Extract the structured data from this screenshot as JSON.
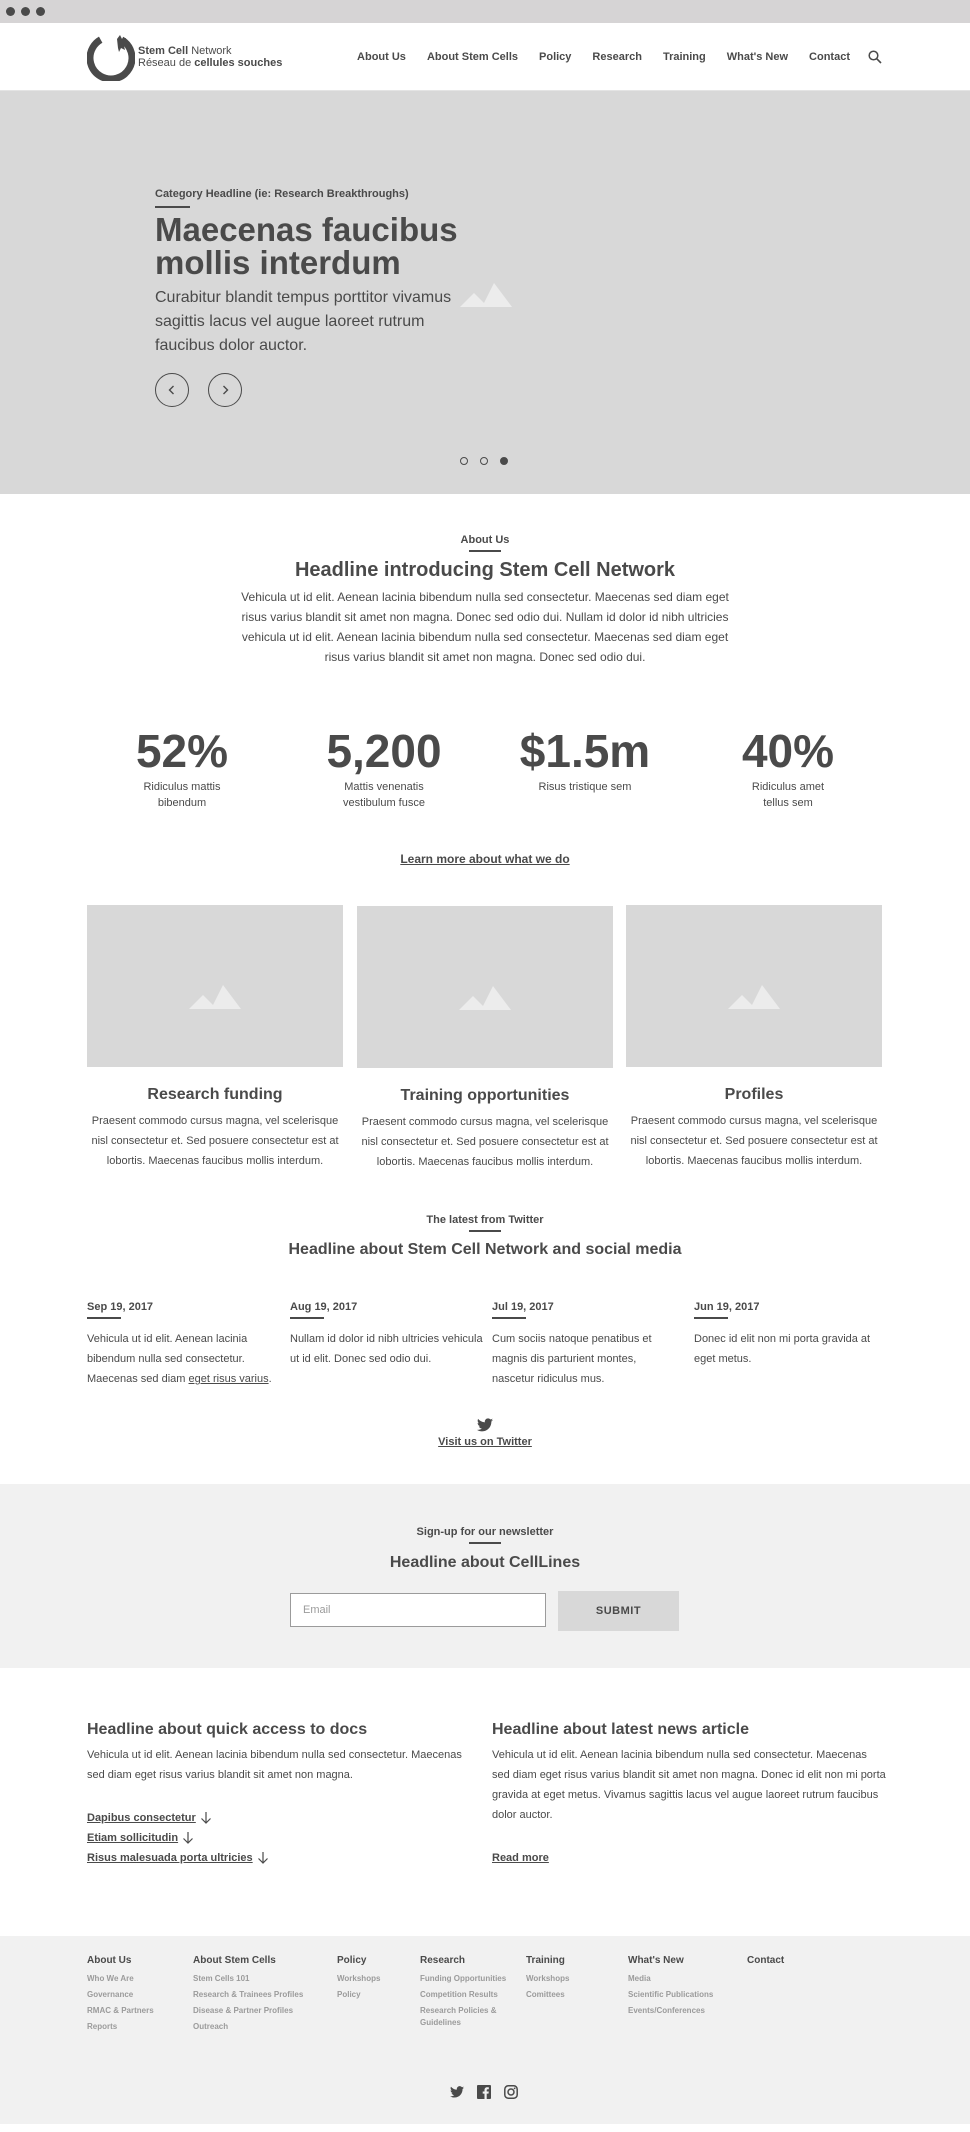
{
  "logo": {
    "line1_bold": "Stem Cell",
    "line1_rest": " Network",
    "line2_rest": "Réseau de ",
    "line2_bold": "cellules souches"
  },
  "nav": {
    "items": [
      "About Us",
      "About Stem Cells",
      "Policy",
      "Research",
      "Training",
      "What's New",
      "Contact"
    ],
    "search_icon": "search-icon"
  },
  "hero": {
    "category": "Category Headline (ie: Research Breakthroughs)",
    "title": "Maecenas faucibus mollis interdum",
    "subtitle": "Curabitur blandit tempus porttitor vivamus sagittis lacus vel augue laoreet rutrum faucibus dolor auctor.",
    "slides_total": 3,
    "active_slide": 3,
    "background": "#d8d8d8"
  },
  "about": {
    "label": "About Us",
    "headline": "Headline introducing Stem Cell Network",
    "body": "Vehicula ut id elit. Aenean lacinia bibendum nulla sed consectetur. Maecenas sed diam eget risus varius blandit sit amet non magna. Donec sed odio dui. Nullam id dolor id nibh ultricies vehicula ut id elit. Aenean lacinia bibendum nulla sed consectetur. Maecenas sed diam eget risus varius blandit sit amet non magna. Donec sed odio dui.",
    "stats": [
      {
        "value": "52%",
        "label": "Ridiculus mattis bibendum"
      },
      {
        "value": "5,200",
        "label": "Mattis venenatis vestibulum fusce"
      },
      {
        "value": "$1.5m",
        "label": "Risus tristique sem"
      },
      {
        "value": "40%",
        "label": "Ridiculus amet tellus sem"
      }
    ],
    "link": "Learn more about what we do"
  },
  "cards": [
    {
      "title": "Research funding",
      "body": "Praesent commodo cursus magna, vel scelerisque nisl consectetur et. Sed posuere consectetur est at lobortis. Maecenas faucibus mollis interdum."
    },
    {
      "title": "Training opportunities",
      "body": "Praesent commodo cursus magna, vel scelerisque nisl consectetur et. Sed posuere consectetur est at lobortis. Maecenas faucibus mollis interdum."
    },
    {
      "title": "Profiles",
      "body": "Praesent commodo cursus magna, vel scelerisque nisl consectetur et. Sed posuere consectetur est at lobortis. Maecenas faucibus mollis interdum."
    }
  ],
  "twitter": {
    "label": "The latest from Twitter",
    "headline": "Headline about Stem Cell Network and social media",
    "tweets": [
      {
        "date": "Sep 19, 2017",
        "body": "Vehicula ut id elit. Aenean lacinia bibendum nulla sed consectetur. Maecenas sed diam ",
        "link": "eget risus varius",
        "after": "."
      },
      {
        "date": "Aug 19, 2017",
        "body": "Nullam id dolor id nibh ultricies vehicula ut id elit. Donec sed odio dui.",
        "link": "",
        "after": ""
      },
      {
        "date": "Jul 19, 2017",
        "body": "Cum sociis natoque penatibus et magnis dis parturient montes, nascetur ridiculus mus.",
        "link": "",
        "after": ""
      },
      {
        "date": "Jun 19, 2017",
        "body": "Donec id elit non mi porta gravida at eget metus.",
        "link": "",
        "after": ""
      }
    ],
    "visit_link": "Visit us on Twitter"
  },
  "newsletter": {
    "label": "Sign-up for our newsletter",
    "headline": "Headline about CellLines",
    "email_placeholder": "Email",
    "submit": "SUBMIT"
  },
  "docs": {
    "headline": "Headline about quick access to docs",
    "body": "Vehicula ut id elit. Aenean lacinia bibendum nulla sed consectetur. Maecenas sed diam eget risus varius blandit sit amet non magna.",
    "links": [
      "Dapibus consectetur",
      "Etiam sollicitudin",
      "Risus malesuada porta ultricies"
    ]
  },
  "news": {
    "headline": "Headline about latest news article",
    "body": "Vehicula ut id elit. Aenean lacinia bibendum nulla sed consectetur. Maecenas sed diam eget risus varius blandit sit amet non magna. Donec id elit non mi porta gravida at eget metus. Vivamus sagittis lacus vel augue laoreet rutrum faucibus dolor auctor.",
    "read_more": "Read more"
  },
  "footer": {
    "columns": [
      {
        "heading": "About Us",
        "items": [
          "Who We Are",
          "Governance",
          "RMAC & Partners",
          "Reports"
        ]
      },
      {
        "heading": "About Stem Cells",
        "items": [
          "Stem Cells 101",
          "Research & Trainees Profiles",
          "Disease & Partner Profiles",
          "Outreach"
        ]
      },
      {
        "heading": "Policy",
        "items": [
          "Workshops",
          "Policy"
        ]
      },
      {
        "heading": "Research",
        "items": [
          "Funding Opportunities",
          "Competition Results",
          "Research Policies & Guidelines"
        ]
      },
      {
        "heading": "Training",
        "items": [
          "Workshops",
          "Comittees"
        ]
      },
      {
        "heading": "What's New",
        "items": [
          "Media",
          "Scientific Publications",
          "Events/Conferences"
        ]
      },
      {
        "heading": "Contact",
        "items": []
      }
    ],
    "social_icons": [
      "twitter-icon",
      "facebook-icon",
      "instagram-icon"
    ]
  }
}
